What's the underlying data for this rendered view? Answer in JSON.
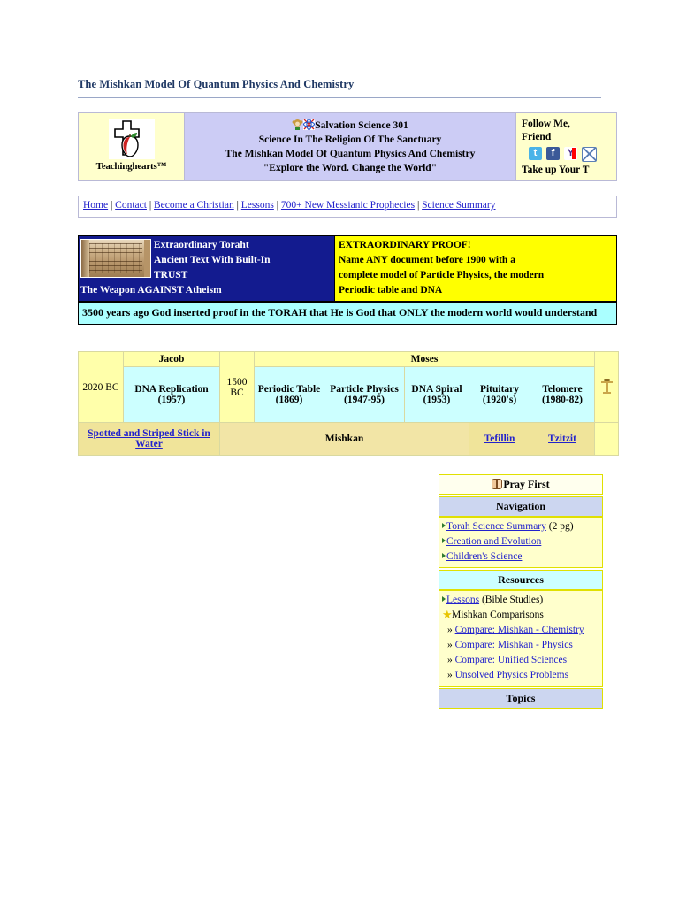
{
  "page_title": "The Mishkan Model Of Quantum Physics And Chemistry",
  "masthead": {
    "brand": "Teachinghearts™",
    "logo_icon": "cross-apple-logo",
    "title_icon_1": "monkey-icon",
    "title_icon_2": "dna-atom-icon",
    "title": "Salvation Science 301",
    "subtitle_1": "Science In The Religion Of The Sanctuary",
    "subtitle_2": "The Mishkan Model Of Quantum Physics And Chemistry",
    "tagline": "\"Explore the Word. Change the World\"",
    "follow_line_1": "Follow Me,",
    "follow_line_2": "Friend",
    "follow_line_3": "Take up Your T",
    "social": [
      {
        "name": "twitter-icon",
        "glyph": "t"
      },
      {
        "name": "facebook-icon",
        "glyph": "f"
      },
      {
        "name": "yahoo-icon",
        "glyph": "Y"
      },
      {
        "name": "email-icon",
        "glyph": ""
      }
    ]
  },
  "navbar": {
    "links": [
      "Home",
      "Contact",
      "Become a Christian",
      "Lessons",
      "700+ New Messianic Prophecies",
      "Science Summary"
    ],
    "separator": "|"
  },
  "promo": {
    "blue": {
      "image": "torah-scroll-image",
      "line_1": "Extraordinary Toraht",
      "line_2": "Ancient Text With Built-In",
      "line_3": "TRUST",
      "line_4": "The Weapon AGAINST Atheism"
    },
    "yellow": {
      "heading": "EXTRAORDINARY PROOF!",
      "line_1": "Name ANY document before 1900 with a",
      "line_2": "complete model of Particle Physics, the modern",
      "line_3": "Periodic table and DNA"
    },
    "cyan_bar": "3500 years ago God inserted proof in the TORAH that He is God that ONLY the modern world would understand"
  },
  "table": {
    "header_jacob": "Jacob",
    "header_moses": "Moses",
    "date_jacob": "2020 BC",
    "date_moses": "1500 BC",
    "jacob_item": "DNA Replication (1957)",
    "moses_items": [
      "Periodic Table (1869)",
      "Particle Physics (1947-95)",
      "DNA Spiral (1953)",
      "Pituitary (1920's)",
      "Telomere (1980-82)"
    ],
    "footer_jacob_link": "Spotted and Striped Stick in Water",
    "footer_mishkan": "Mishkan",
    "footer_tefillin": "Tefillin",
    "footer_tzitzit": "Tzitzit",
    "menorah_icon": "menorah-icon"
  },
  "sidebar": {
    "pray": {
      "icon": "praying-hands-icon",
      "label": "Pray First"
    },
    "navigation": {
      "heading": "Navigation",
      "items": [
        {
          "link": "Torah Science Summary",
          "suffix": " (2 pg)"
        },
        {
          "link": "Creation and Evolution",
          "suffix": ""
        },
        {
          "link": "Children's Science",
          "suffix": ""
        }
      ]
    },
    "resources": {
      "heading": "Resources",
      "lessons_link": "Lessons",
      "lessons_suffix": " (Bible Studies)",
      "comparisons_label": "Mishkan Comparisons",
      "sub_items": [
        "Compare: Mishkan - Chemistry",
        "Compare: Mishkan - Physics",
        "Compare: Unified Sciences",
        "Unsolved Physics Problems"
      ],
      "sub_marker": "»"
    },
    "topics": {
      "heading": "Topics"
    }
  },
  "colors": {
    "title": "#1f3864",
    "mast_center_bg": "#ccccf5",
    "mast_side_bg": "#ffffcc",
    "promo_blue": "#131b8f",
    "promo_yellow": "#ffff00",
    "cyan": "#aaffff",
    "link": "#2222cc",
    "table_yellow": "#ffffaa",
    "table_cyan": "#ccffff",
    "table_khaki": "#f0e49a",
    "sidebar_border": "#e0e000",
    "sidebar_lavender": "#ccd6f0"
  }
}
